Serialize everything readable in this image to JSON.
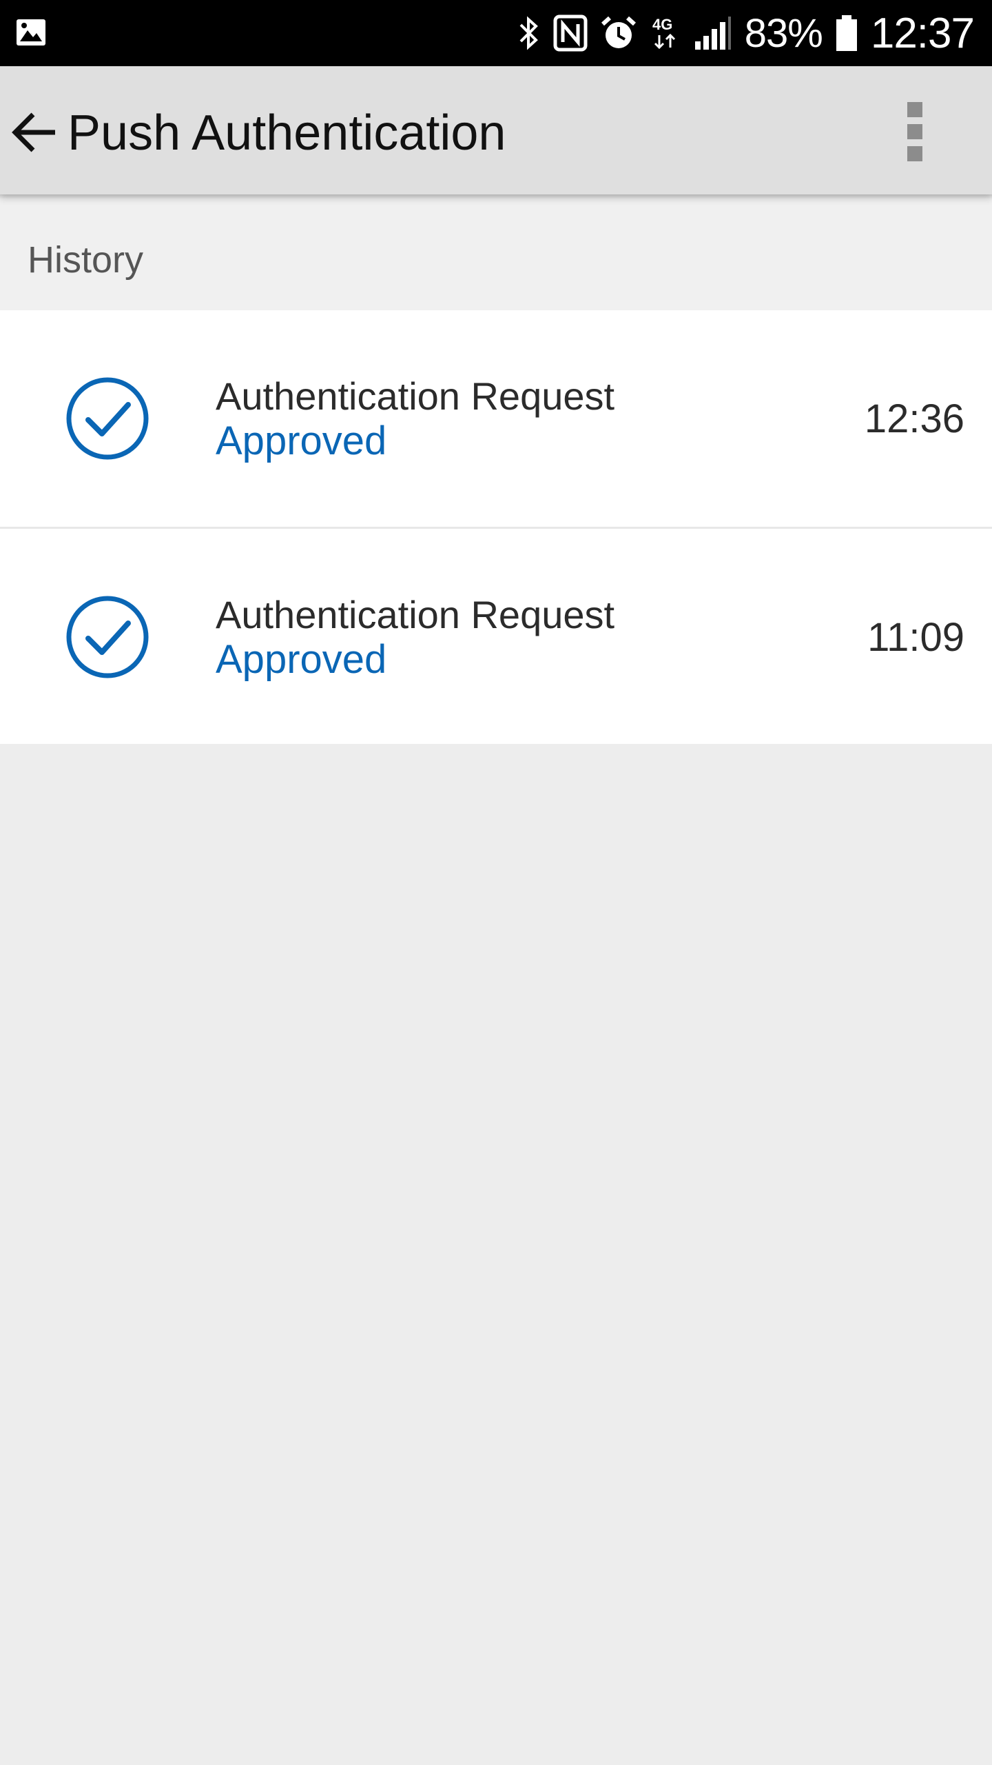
{
  "status_bar": {
    "battery": "83%",
    "time": "12:37",
    "network": "4G",
    "icons": [
      "image-icon",
      "bluetooth-icon",
      "nfc-icon",
      "alarm-icon",
      "4g-icon",
      "signal-icon",
      "battery-icon"
    ]
  },
  "app_bar": {
    "title": "Push Authentication",
    "back_icon": "back-arrow-icon",
    "menu_icon": "overflow-menu-icon"
  },
  "section": {
    "title": "History"
  },
  "history": [
    {
      "title": "Authentication Request",
      "status": "Approved",
      "time": "12:36",
      "icon": "check-circle-icon"
    },
    {
      "title": "Authentication Request",
      "status": "Approved",
      "time": "11:09",
      "icon": "check-circle-icon"
    }
  ],
  "colors": {
    "accent": "#0a66b5",
    "status_bar": "#000000",
    "app_bar": "#dfdfdf",
    "background": "#ededed"
  }
}
